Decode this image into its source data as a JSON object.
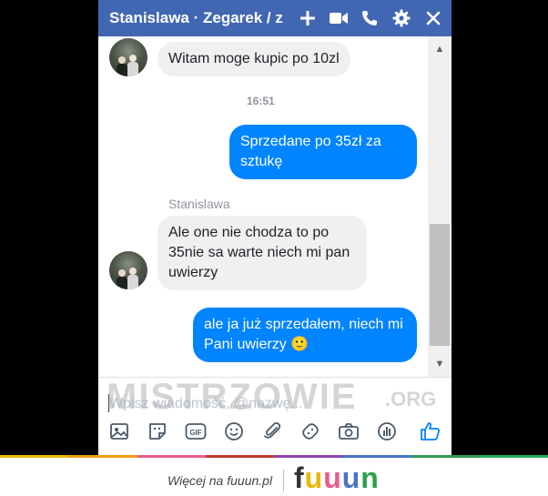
{
  "header": {
    "title": "Stanislawa · Zegarek / z",
    "icons": [
      "plus-icon",
      "video-call-icon",
      "phone-icon",
      "gear-icon",
      "close-icon"
    ],
    "color": "#4267b2"
  },
  "messages": [
    {
      "direction": "incoming",
      "text": "Witam moge kupic po 10zl"
    },
    {
      "type": "timestamp",
      "text": "16:51"
    },
    {
      "direction": "outgoing",
      "text": "Sprzedane po 35zł za sztukę"
    },
    {
      "type": "sender",
      "text": "Stanislawa"
    },
    {
      "direction": "incoming",
      "text": "Ale one nie chodza to po 35nie sa warte niech mi pan uwierzy"
    },
    {
      "direction": "outgoing",
      "text": "ale ja już sprzedałem, niech mi Pani uwierzy",
      "emoji": "🙂"
    }
  ],
  "composer": {
    "placeholder": "Wpisz wiadomość, @nazwę..."
  },
  "toolbar": [
    "image-icon",
    "sticker-icon",
    "gif-icon",
    "emoji-icon",
    "attachment-icon",
    "game-controller-icon",
    "camera-icon",
    "poll-icon",
    "like-icon"
  ],
  "watermark": {
    "text": "MISTRZOWIE",
    "suffix": ".ORG"
  },
  "footer": {
    "text": "Więcej na fuuun.pl",
    "logo": "fuuun",
    "logo_colors": [
      "#333333",
      "#e8b800",
      "#e85c8a",
      "#4a73c7",
      "#2e9e4f"
    ]
  },
  "colors": {
    "outgoing_bubble": "#0084ff",
    "incoming_bubble": "#f1f0f0",
    "like_icon": "#0084ff"
  }
}
